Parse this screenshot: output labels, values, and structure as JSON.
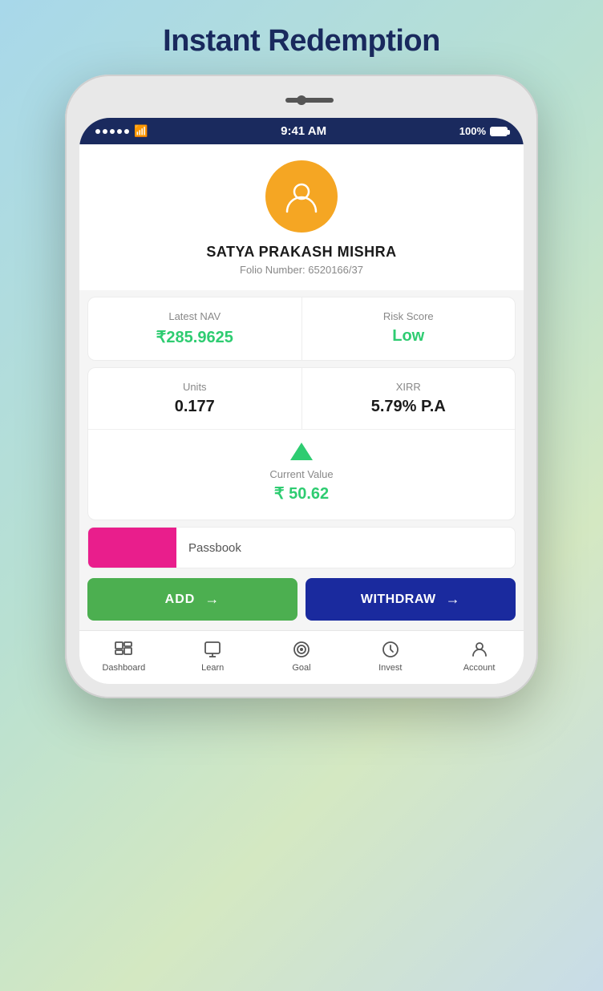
{
  "page": {
    "title": "Instant Redemption"
  },
  "statusBar": {
    "time": "9:41 AM",
    "battery": "100%"
  },
  "user": {
    "name": "SATYA PRAKASH MISHRA",
    "folioLabel": "Folio Number:",
    "folioNumber": "6520166/37"
  },
  "stats": {
    "navLabel": "Latest NAV",
    "navValue": "₹285.9625",
    "riskLabel": "Risk Score",
    "riskValue": "Low"
  },
  "metrics": {
    "unitsLabel": "Units",
    "unitsValue": "0.177",
    "xirrLabel": "XIRR",
    "xirrValue": "5.79% P.A",
    "currentValueLabel": "Current Value",
    "currentValueAmount": "₹ 50.62"
  },
  "passbook": {
    "label": "Passbook"
  },
  "buttons": {
    "add": "ADD",
    "withdraw": "WITHDRAW"
  },
  "nav": {
    "items": [
      {
        "label": "Dashboard",
        "icon": "dashboard-icon"
      },
      {
        "label": "Learn",
        "icon": "learn-icon"
      },
      {
        "label": "Goal",
        "icon": "goal-icon"
      },
      {
        "label": "Invest",
        "icon": "invest-icon"
      },
      {
        "label": "Account",
        "icon": "account-icon"
      }
    ]
  }
}
